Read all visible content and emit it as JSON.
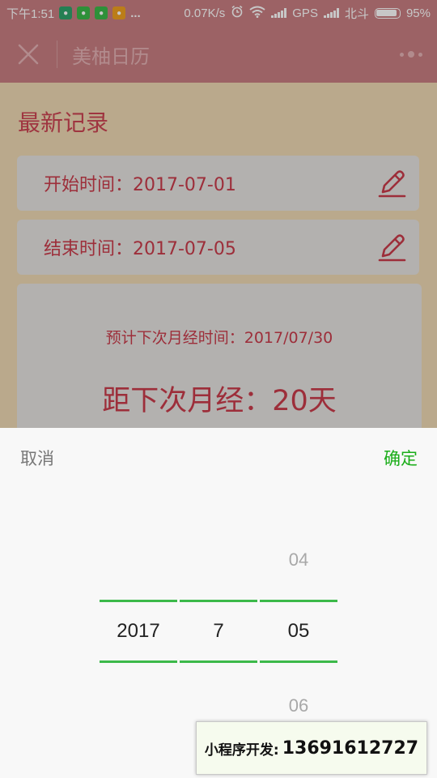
{
  "status_bar": {
    "time": "下午1:51",
    "more": "...",
    "speed": "0.07K/s",
    "gps": "GPS",
    "beidou": "北斗",
    "battery": "95%"
  },
  "navbar": {
    "title": "美柚日历"
  },
  "main": {
    "section_title": "最新记录",
    "start_record": "开始时间：2017-07-01",
    "end_record": "结束时间：2017-07-05",
    "prediction": "预计下次月经时间：2017/07/30",
    "countdown": "距下次月经：20天"
  },
  "picker": {
    "cancel_label": "取消",
    "confirm_label": "确定",
    "year": {
      "selected": "2017"
    },
    "month": {
      "selected": "7"
    },
    "day": {
      "prev": "04",
      "selected": "05",
      "next": "06"
    }
  },
  "promo": {
    "label": "小程序开发:",
    "phone": "13691612727"
  },
  "colors": {
    "accent_green": "#1aad19",
    "text_red": "#c93c4b",
    "navbar_pink": "#c87e82",
    "page_background": "#efd9b4"
  }
}
